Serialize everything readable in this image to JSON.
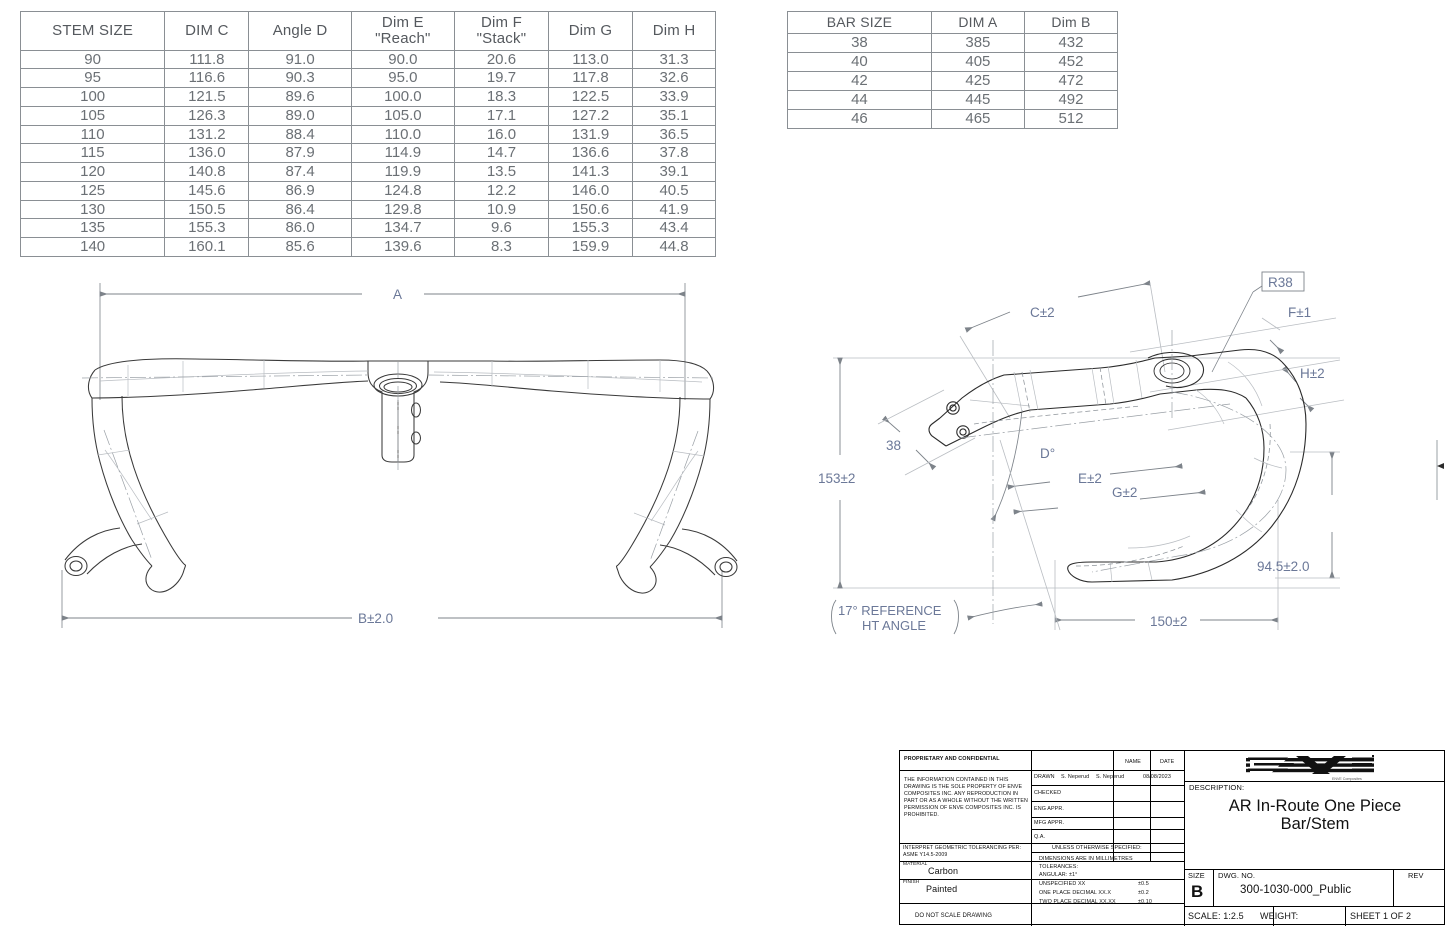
{
  "stem_table": {
    "headers": [
      "STEM SIZE",
      "DIM C",
      "Angle D",
      "Dim E\n\"Reach\"",
      "Dim F\n\"Stack\"",
      "Dim G",
      "Dim H"
    ],
    "rows": [
      [
        "90",
        "111.8",
        "91.0",
        "90.0",
        "20.6",
        "113.0",
        "31.3"
      ],
      [
        "95",
        "116.6",
        "90.3",
        "95.0",
        "19.7",
        "117.8",
        "32.6"
      ],
      [
        "100",
        "121.5",
        "89.6",
        "100.0",
        "18.3",
        "122.5",
        "33.9"
      ],
      [
        "105",
        "126.3",
        "89.0",
        "105.0",
        "17.1",
        "127.2",
        "35.1"
      ],
      [
        "110",
        "131.2",
        "88.4",
        "110.0",
        "16.0",
        "131.9",
        "36.5"
      ],
      [
        "115",
        "136.0",
        "87.9",
        "114.9",
        "14.7",
        "136.6",
        "37.8"
      ],
      [
        "120",
        "140.8",
        "87.4",
        "119.9",
        "13.5",
        "141.3",
        "39.1"
      ],
      [
        "125",
        "145.6",
        "86.9",
        "124.8",
        "12.2",
        "146.0",
        "40.5"
      ],
      [
        "130",
        "150.5",
        "86.4",
        "129.8",
        "10.9",
        "150.6",
        "41.9"
      ],
      [
        "135",
        "155.3",
        "86.0",
        "134.7",
        "9.6",
        "155.3",
        "43.4"
      ],
      [
        "140",
        "160.1",
        "85.6",
        "139.6",
        "8.3",
        "159.9",
        "44.8"
      ]
    ]
  },
  "bar_table": {
    "headers": [
      "BAR SIZE",
      "DIM A",
      "Dim B"
    ],
    "rows": [
      [
        "38",
        "385",
        "432"
      ],
      [
        "40",
        "405",
        "452"
      ],
      [
        "42",
        "425",
        "472"
      ],
      [
        "44",
        "445",
        "492"
      ],
      [
        "46",
        "465",
        "512"
      ]
    ]
  },
  "dimensions": {
    "top_view": {
      "width_a": "A",
      "width_b": "B±2.0"
    },
    "side_view": {
      "radius": "R38",
      "f": "F±1",
      "h": "H±2",
      "c": "C±2",
      "e": "E±2",
      "g": "G±2",
      "angle_d": "D°",
      "stem_clamp": "38",
      "stack_height": "153±2",
      "drop": "94.5±2.0",
      "reach_overall": "150±2",
      "ht_note_line1": "17° REFERENCE",
      "ht_note_line2": "HT ANGLE"
    }
  },
  "title_block": {
    "proprietary_header": "PROPRIETARY AND CONFIDENTIAL",
    "proprietary_body": "THE INFORMATION CONTAINED IN THIS DRAWING IS THE SOLE PROPERTY OF ENVE COMPOSITES INC. ANY REPRODUCTION IN PART OR AS A WHOLE WITHOUT THE WRITTEN PERMISSION OF ENVE COMPOSITES INC. IS PROHIBITED.",
    "gd_t_note": "INTERPRET GEOMETRIC TOLERANCING PER: ASME Y14.5-2009",
    "material_label": "MATERIAL",
    "material_value": "Carbon",
    "finish_label": "FINISH",
    "finish_value": "Painted",
    "do_not_scale": "DO NOT SCALE DRAWING",
    "col_name": "NAME",
    "col_date": "DATE",
    "approval_rows": [
      {
        "label": "DRAWN",
        "name": "S. Neperud",
        "date": "08/08/2023"
      },
      {
        "label": "CHECKED",
        "name": "",
        "date": ""
      },
      {
        "label": "ENG APPR.",
        "name": "",
        "date": ""
      },
      {
        "label": "MFG APPR.",
        "name": "",
        "date": ""
      },
      {
        "label": "Q.A.",
        "name": "",
        "date": ""
      }
    ],
    "unless_specified": "UNLESS OTHERWISE SPECIFIED:",
    "tolerance_lines": [
      "DIMENSIONS ARE IN MILLIMETRES",
      "TOLERANCES:",
      "ANGULAR: ±1°"
    ],
    "tolerance_rows": [
      {
        "label": "UNSPECIFIED XX",
        "value": "±0.5"
      },
      {
        "label": "ONE PLACE DECIMAL XX.X",
        "value": "±0.2"
      },
      {
        "label": "TWO PLACE DECIMAL XX.XX",
        "value": "±0.10"
      }
    ],
    "logo_text": "ENVE",
    "logo_sub": "ENVE Composites",
    "description_label": "DESCRIPTION:",
    "description_line1": "AR In-Route One Piece",
    "description_line2": "Bar/Stem",
    "size_label": "SIZE",
    "size_value": "B",
    "dwg_no_label": "DWG.  NO.",
    "dwg_no_value": "300-1030-000_Public",
    "rev_label": "REV",
    "rev_value": "",
    "scale_label": "SCALE: 1:2.5",
    "weight_label": "WEIGHT:",
    "sheet_label": "SHEET 1 OF 2"
  },
  "colors": {
    "dim_text": "#6b7898",
    "line": "#7d838a",
    "part_outline": "#2b2b2b",
    "table_border": "#8a8f94"
  }
}
